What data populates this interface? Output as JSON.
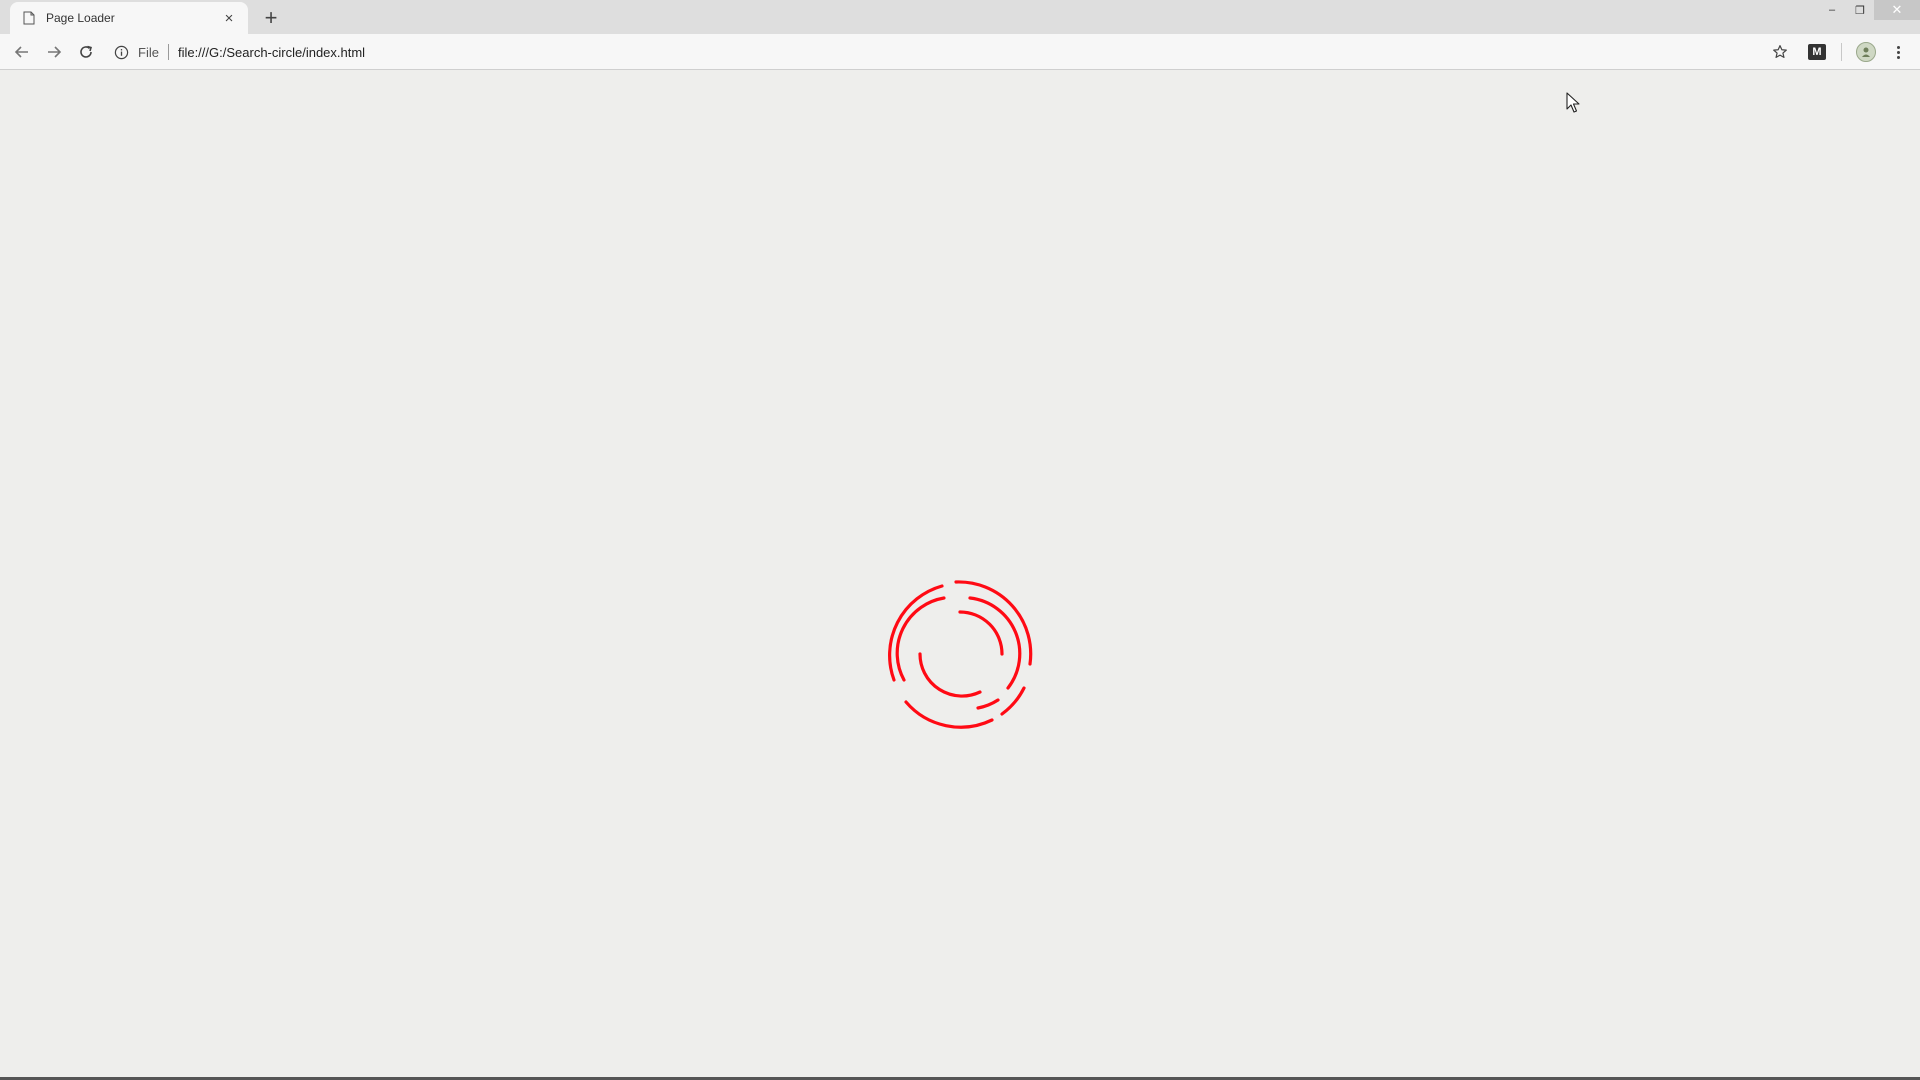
{
  "browser": {
    "tab": {
      "title": "Page Loader",
      "close_glyph": "×"
    },
    "new_tab_glyph": "+",
    "window_controls": {
      "minimize": "–",
      "restore": "❐",
      "close": "✕"
    },
    "address": {
      "security_chip": "File",
      "url": "file:///G:/Search-circle/index.html"
    },
    "extension_label": "M"
  },
  "loader": {
    "color": "#ff0a14",
    "rings": 2
  }
}
